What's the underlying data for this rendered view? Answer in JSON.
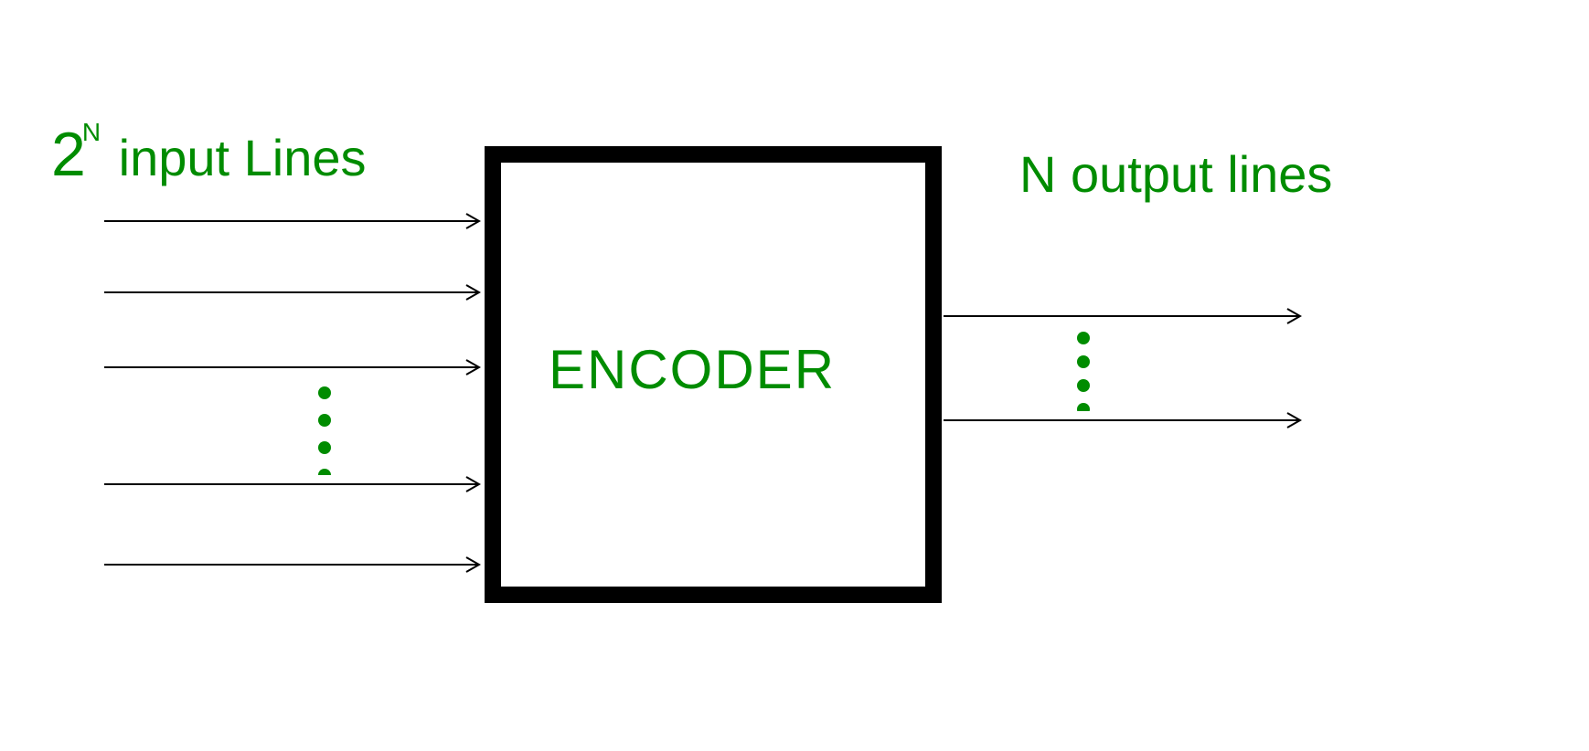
{
  "labels": {
    "input_base": "2",
    "input_exp": "N",
    "input_text": " input Lines",
    "output_text": "N output lines",
    "box_label": "ENCODER"
  },
  "diagram": {
    "type": "block-diagram",
    "component": "Encoder",
    "inputs": "2^N input lines",
    "outputs": "N output lines",
    "input_arrow_count": 5,
    "output_arrow_count": 2,
    "colors": {
      "text": "#008c00",
      "box_border": "#000000",
      "arrows": "#000000"
    }
  }
}
